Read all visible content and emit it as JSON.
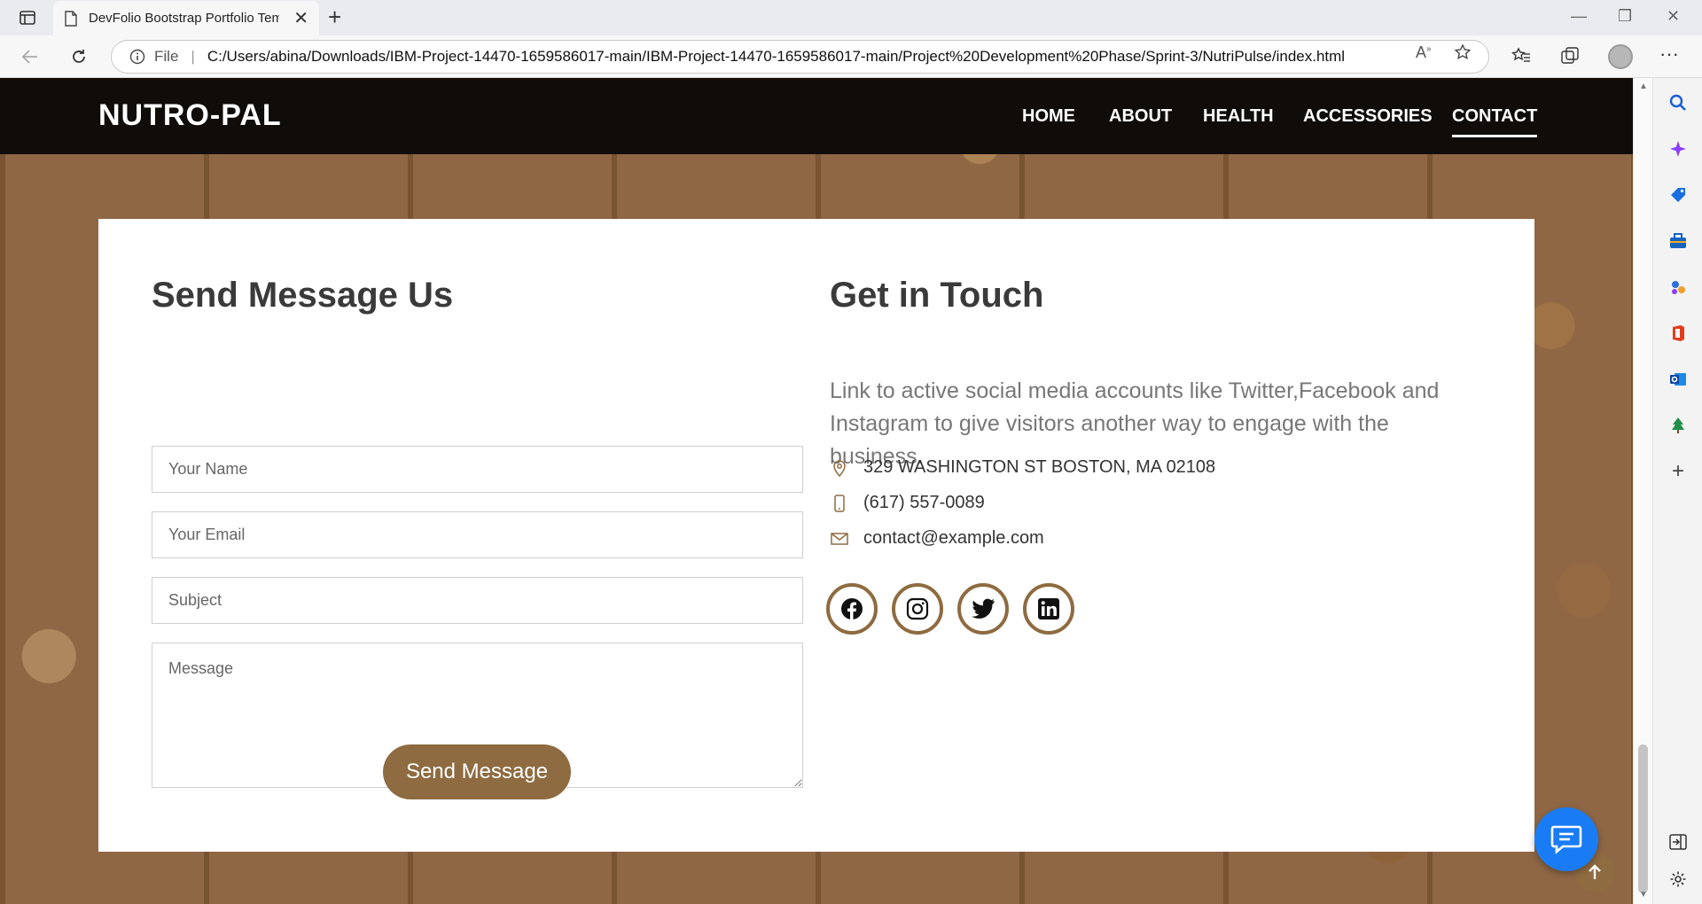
{
  "browser": {
    "tab_title": "DevFolio Bootstrap Portfolio Tem",
    "tab_close": "✕",
    "new_tab": "+",
    "url_scheme_label": "File",
    "url": "C:/Users/abina/Downloads/IBM-Project-14470-1659586017-main/IBM-Project-14470-1659586017-main/Project%20Development%20Phase/Sprint-3/NutriPulse/index.html",
    "minimize": "—",
    "restore": "❐",
    "close": "✕",
    "more": "···"
  },
  "site": {
    "brand": "NUTRO-PAL",
    "nav": {
      "home": "HOME",
      "about": "ABOUT",
      "health": "HEALTH",
      "accessories": "ACCESSORIES",
      "contact": "CONTACT"
    },
    "active_nav": "CONTACT"
  },
  "contact_form": {
    "heading": "Send Message Us",
    "name_placeholder": "Your Name",
    "email_placeholder": "Your Email",
    "subject_placeholder": "Subject",
    "message_placeholder": "Message",
    "submit_label": "Send Message"
  },
  "get_in_touch": {
    "heading": "Get in Touch",
    "description": "Link to active social media accounts like Twitter,Facebook and Instagram to give visitors another way to engage with the business.",
    "address": "329 WASHINGTON ST BOSTON, MA 02108",
    "phone": "(617) 557-0089",
    "email": "contact@example.com",
    "socials": [
      "facebook-icon",
      "instagram-icon",
      "twitter-icon",
      "linkedin-icon"
    ]
  },
  "colors": {
    "accent": "#8e6b40",
    "nav_bg": "#0f0c0a",
    "chat_button": "#1a7cf5"
  }
}
